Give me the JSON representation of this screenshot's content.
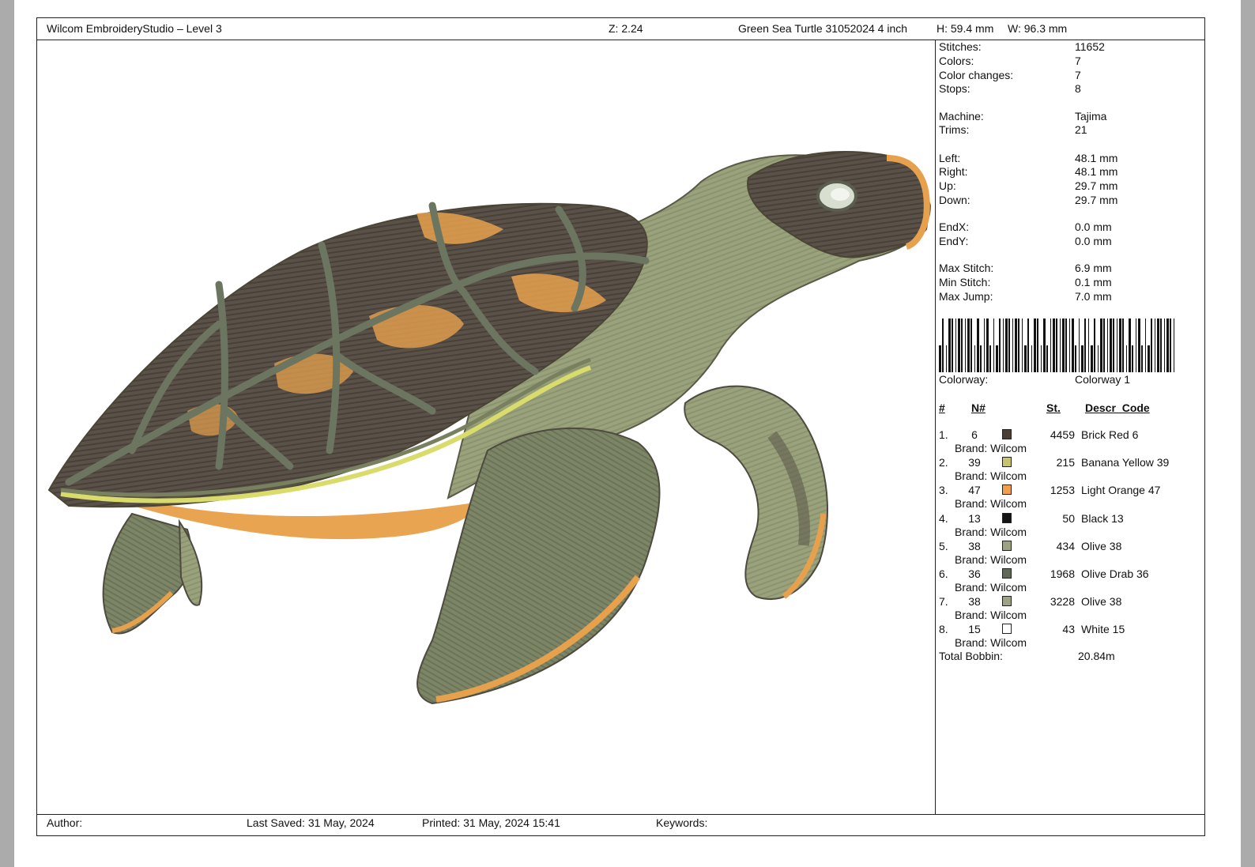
{
  "header": {
    "app_title": "Wilcom EmbroideryStudio – Level 3",
    "zoom": "Z: 2.24",
    "design_name": "Green Sea Turtle 31052024 4 inch",
    "height": "H: 59.4 mm",
    "width": "W: 96.3 mm"
  },
  "stats": [
    {
      "label": "Stitches:",
      "value": "11652"
    },
    {
      "label": "Colors:",
      "value": "7"
    },
    {
      "label": "Color changes:",
      "value": "7"
    },
    {
      "label": "Stops:",
      "value": "8"
    },
    {
      "label": "Machine:",
      "value": "Tajima"
    },
    {
      "label": "Trims:",
      "value": "21"
    },
    {
      "label": "Left:",
      "value": "48.1 mm"
    },
    {
      "label": "Right:",
      "value": "48.1 mm"
    },
    {
      "label": "Up:",
      "value": "29.7 mm"
    },
    {
      "label": "Down:",
      "value": "29.7 mm"
    },
    {
      "label": "EndX:",
      "value": "0.0 mm"
    },
    {
      "label": "EndY:",
      "value": "0.0 mm"
    },
    {
      "label": "Max Stitch:",
      "value": "6.9 mm"
    },
    {
      "label": "Min Stitch:",
      "value": "0.1 mm"
    },
    {
      "label": "Max Jump:",
      "value": "7.0 mm"
    }
  ],
  "colorway": {
    "label": "Colorway:",
    "value": "Colorway 1"
  },
  "table_headers": {
    "num": "#",
    "n": "N#",
    "st": "St.",
    "descr": "Descr_Code"
  },
  "colors": [
    {
      "idx": "1.",
      "n": "6",
      "st": "4459",
      "descr": "Brick Red 6",
      "brand": "Brand: Wilcom",
      "hex": "#4a3f35"
    },
    {
      "idx": "2.",
      "n": "39",
      "st": "215",
      "descr": "Banana Yellow 39",
      "brand": "Brand: Wilcom",
      "hex": "#c8c46a"
    },
    {
      "idx": "3.",
      "n": "47",
      "st": "1253",
      "descr": "Light Orange 47",
      "brand": "Brand: Wilcom",
      "hex": "#f0a04b"
    },
    {
      "idx": "4.",
      "n": "13",
      "st": "50",
      "descr": "Black 13",
      "brand": "Brand: Wilcom",
      "hex": "#141414"
    },
    {
      "idx": "5.",
      "n": "38",
      "st": "434",
      "descr": "Olive 38",
      "brand": "Brand: Wilcom",
      "hex": "#9da283"
    },
    {
      "idx": "6.",
      "n": "36",
      "st": "1968",
      "descr": "Olive Drab 36",
      "brand": "Brand: Wilcom",
      "hex": "#616858"
    },
    {
      "idx": "7.",
      "n": "38",
      "st": "3228",
      "descr": "Olive 38",
      "brand": "Brand: Wilcom",
      "hex": "#9da283"
    },
    {
      "idx": "8.",
      "n": "15",
      "st": "43",
      "descr": "White 15",
      "brand": "Brand: Wilcom",
      "hex": "#ffffff"
    }
  ],
  "total_bobbin": {
    "label": "Total Bobbin:",
    "value": "20.84m"
  },
  "footer": {
    "author": "Author:",
    "last_saved": "Last Saved: 31 May, 2024",
    "printed": "Printed: 31 May, 2024 15:41",
    "keywords": "Keywords:"
  }
}
